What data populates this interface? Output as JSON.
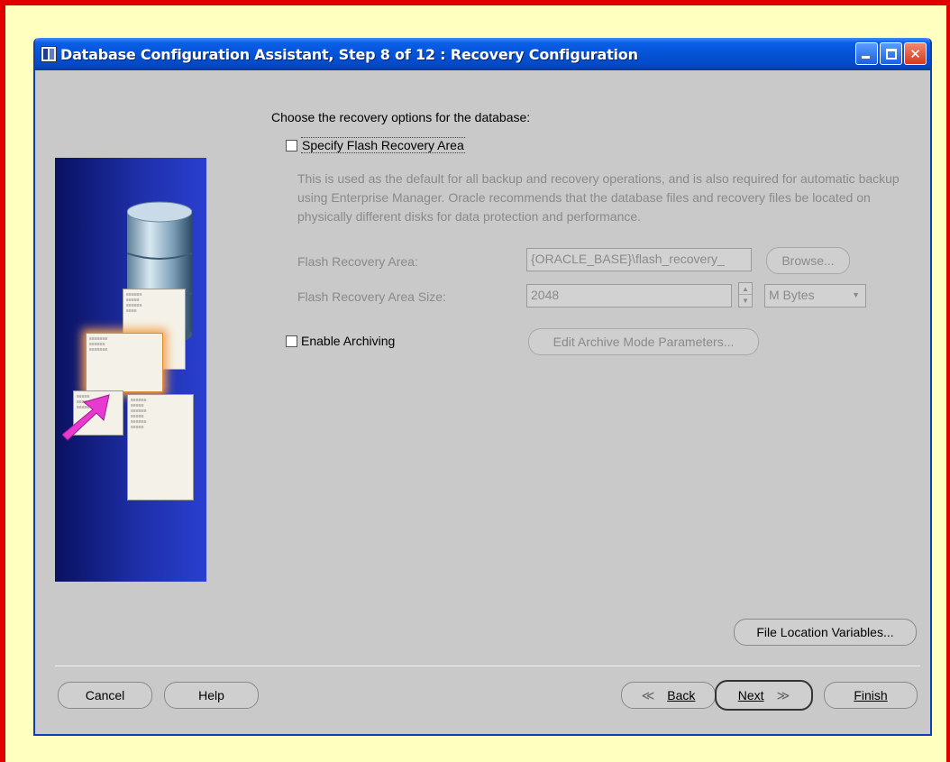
{
  "window": {
    "title": "Database Configuration Assistant, Step 8 of 12 : Recovery Configuration"
  },
  "main": {
    "prompt": "Choose the recovery options for the database:",
    "flash_recovery": {
      "checkbox_label": "Specify Flash Recovery Area",
      "checked": false,
      "description": "This is used as the default for all backup and recovery operations, and is also required for automatic backup using Enterprise Manager. Oracle recommends that the database files and recovery files be located on physically different disks for data protection and performance.",
      "area_label": "Flash Recovery Area:",
      "area_value": "{ORACLE_BASE}\\flash_recovery_",
      "browse_label": "Browse...",
      "size_label": "Flash Recovery Area Size:",
      "size_value": "2048",
      "unit_value": "M Bytes"
    },
    "archiving": {
      "checkbox_label": "Enable Archiving",
      "checked": false,
      "edit_params_label": "Edit Archive Mode Parameters..."
    },
    "file_location_label": "File Location Variables..."
  },
  "footer": {
    "cancel_label": "Cancel",
    "help_label": "Help",
    "back_label": "Back",
    "next_label": "Next",
    "finish_label": "Finish"
  },
  "colors": {
    "title_bar": "#0553d6",
    "window_bg": "#c9c9c9",
    "page_bg": "#ffffc0",
    "frame": "#e00000",
    "disabled_text": "#8a8a8a"
  }
}
